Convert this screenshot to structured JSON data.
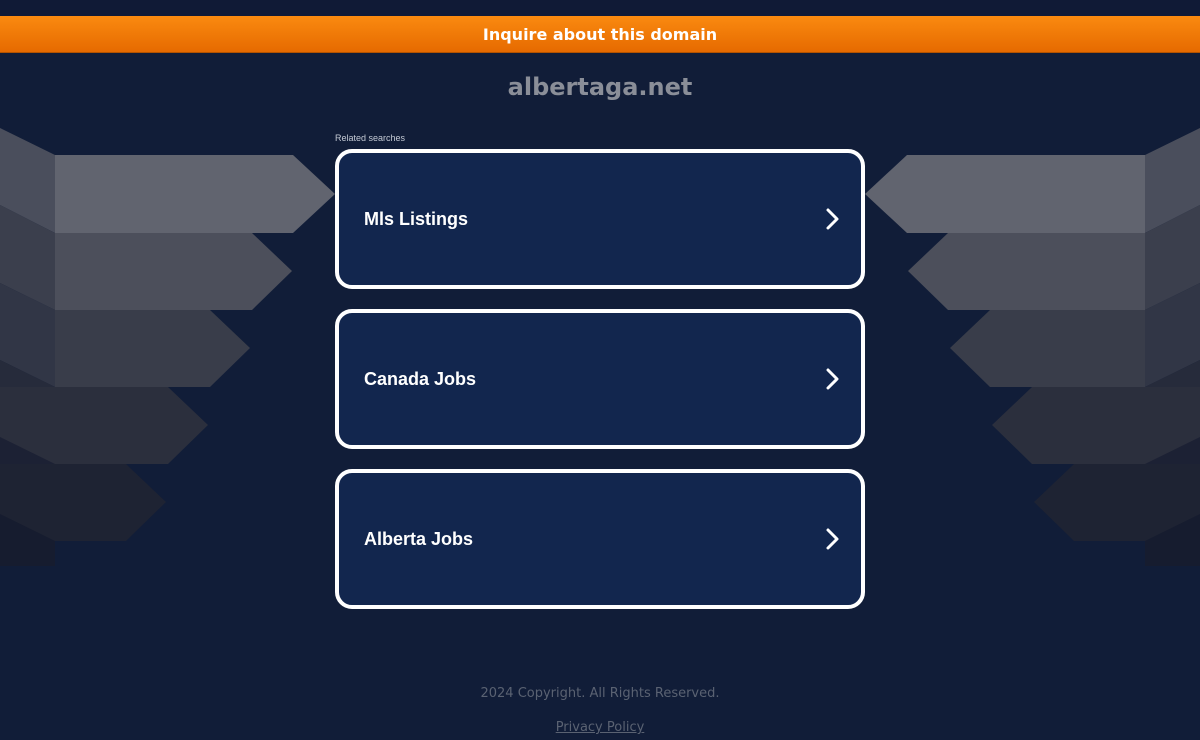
{
  "banner": {
    "inquire_label": "Inquire about this domain",
    "color_top": "#fa8a10",
    "color_bottom": "#e66a00"
  },
  "domain": {
    "name": "albertaga.net"
  },
  "related": {
    "label": "Related searches",
    "items": [
      {
        "label": "Mls Listings",
        "icon": "chevron-right-icon"
      },
      {
        "label": "Canada Jobs",
        "icon": "chevron-right-icon"
      },
      {
        "label": "Alberta Jobs",
        "icon": "chevron-right-icon"
      }
    ]
  },
  "footer": {
    "copyright": "2024 Copyright. All Rights Reserved.",
    "privacy_label": "Privacy Policy"
  },
  "colors": {
    "background": "#111d38",
    "card_background": "#12264e",
    "card_border": "#ffffff",
    "title_text": "#8a8e98"
  }
}
